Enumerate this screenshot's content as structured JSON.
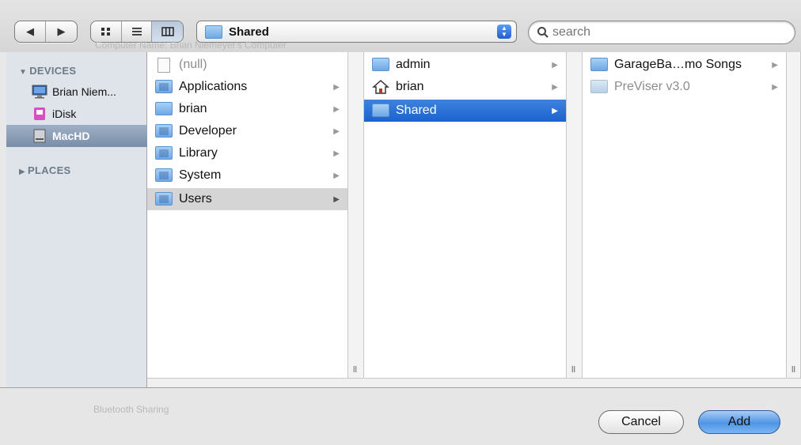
{
  "toolbar": {
    "path_popup_label": "Shared",
    "search_placeholder": "search",
    "ghost_text": "Computer Name:   Brian Niemeyer's Computer"
  },
  "sidebar": {
    "devices_title": "DEVICES",
    "places_title": "PLACES",
    "devices": [
      {
        "label": "Brian Niem...",
        "icon": "computer-icon"
      },
      {
        "label": "iDisk",
        "icon": "idisk-icon"
      },
      {
        "label": "MacHD",
        "icon": "hard-drive-icon",
        "selected": true
      }
    ]
  },
  "column1": {
    "items": [
      {
        "label": "(null)",
        "icon": "document-icon"
      },
      {
        "label": "Applications",
        "icon": "folder-applications-icon"
      },
      {
        "label": "brian",
        "icon": "folder-icon"
      },
      {
        "label": "Developer",
        "icon": "folder-developer-icon"
      },
      {
        "label": "Library",
        "icon": "folder-library-icon"
      },
      {
        "label": "System",
        "icon": "folder-system-icon"
      },
      {
        "label": "Users",
        "icon": "folder-users-icon",
        "selected": true
      }
    ]
  },
  "column2": {
    "items": [
      {
        "label": "admin",
        "icon": "folder-icon"
      },
      {
        "label": "brian",
        "icon": "home-icon"
      },
      {
        "label": "Shared",
        "icon": "folder-icon",
        "selected": true
      }
    ]
  },
  "column3": {
    "items": [
      {
        "label": "GarageBa…mo Songs",
        "icon": "folder-icon"
      },
      {
        "label": "PreViser v3.0",
        "icon": "folder-icon",
        "dim": true
      }
    ]
  },
  "bottom": {
    "ghost_text": "Bluetooth Sharing",
    "cancel_label": "Cancel",
    "add_label": "Add"
  },
  "colors": {
    "selection_blue": "#1b62cf",
    "sidebar_bg": "#dee4ea",
    "folder_blue": "#6ea9e4"
  }
}
